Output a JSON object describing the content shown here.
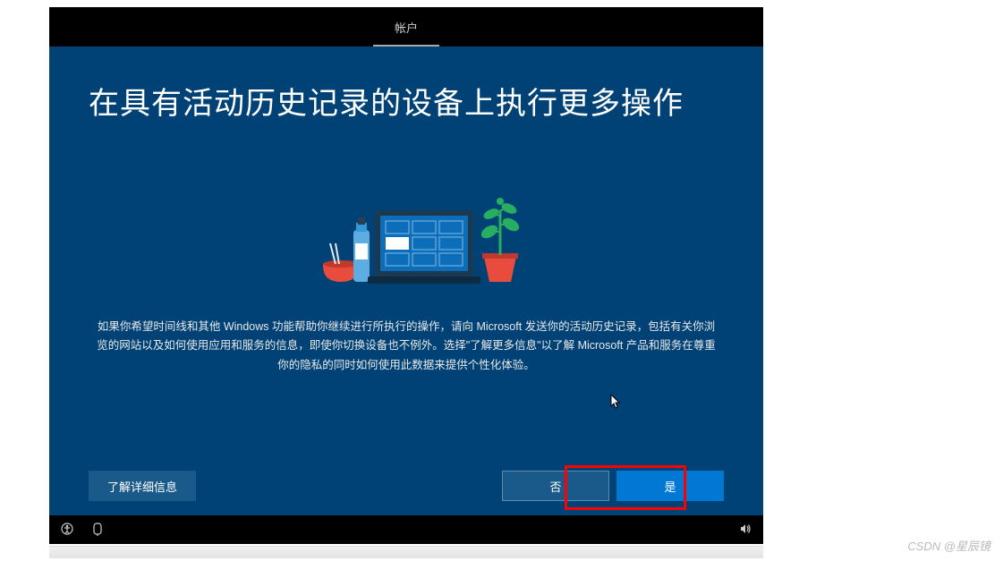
{
  "topbar": {
    "tab_label": "帐户"
  },
  "main": {
    "heading": "在具有活动历史记录的设备上执行更多操作",
    "description": "如果你希望时间线和其他 Windows 功能帮助你继续进行所执行的操作，请向 Microsoft 发送你的活动历史记录，包括有关你浏览的网站以及如何使用应用和服务的信息，即使你切换设备也不例外。选择\"了解更多信息\"以了解 Microsoft 产品和服务在尊重你的隐私的同时如何使用此数据来提供个性化体验。"
  },
  "buttons": {
    "learn_more": "了解详细信息",
    "no": "否",
    "yes": "是"
  },
  "watermark": "CSDN @星辰镜",
  "icons": {
    "accessibility": "accessibility",
    "ime": "ime",
    "volume": "volume"
  }
}
